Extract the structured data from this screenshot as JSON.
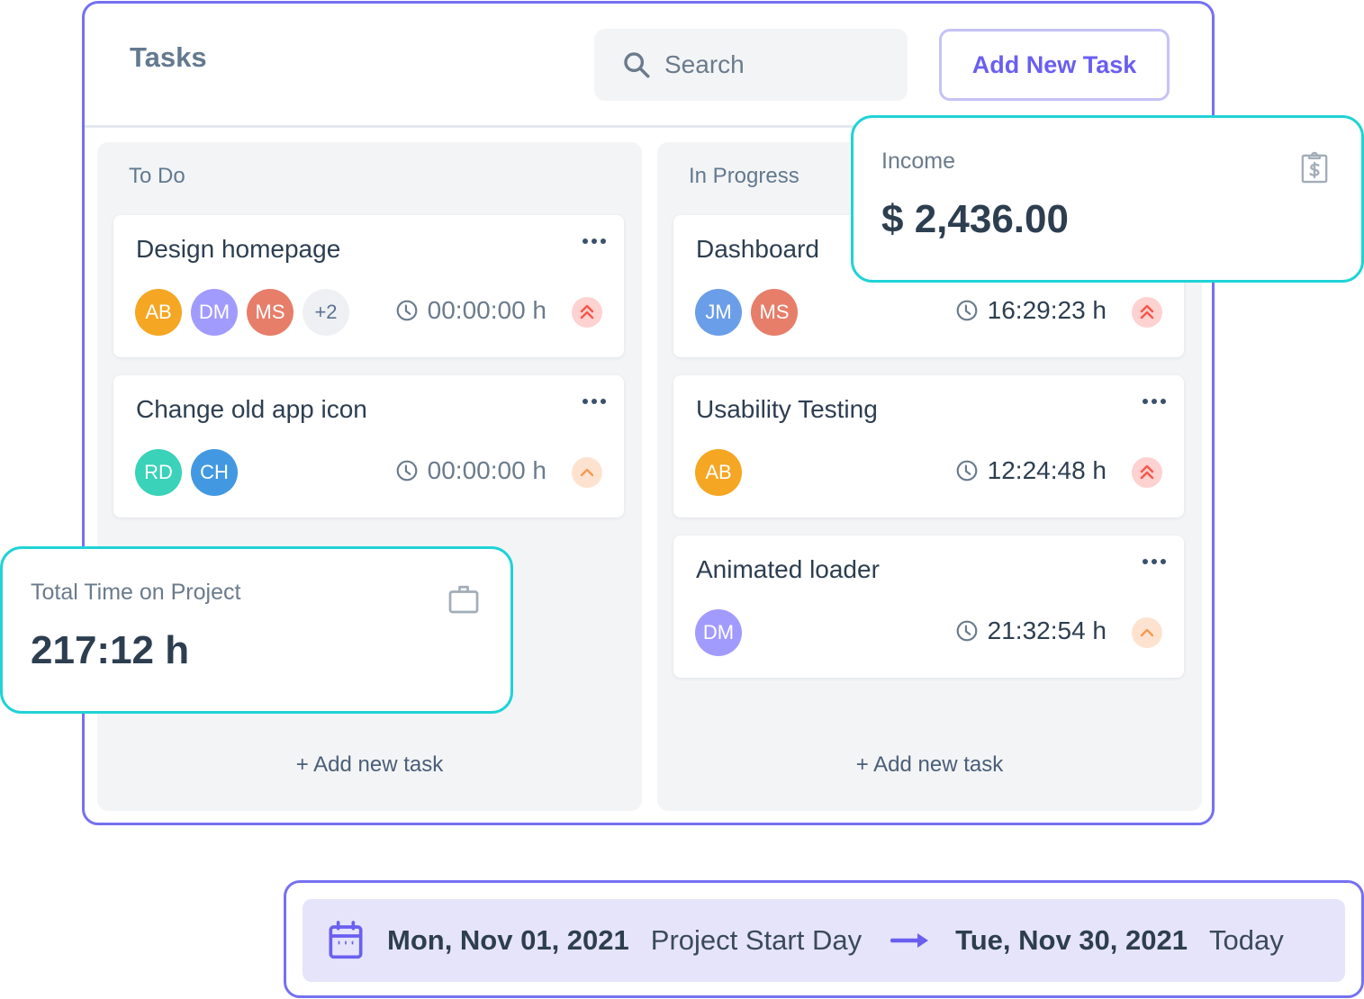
{
  "header": {
    "title": "Tasks",
    "search_placeholder": "Search",
    "search_value": "",
    "add_button": "Add New Task"
  },
  "columns": [
    {
      "title": "To Do",
      "add_label": "+ Add new task",
      "cards": [
        {
          "title": "Design homepage",
          "avatars": [
            {
              "initials": "AB",
              "color": "#f5a623"
            },
            {
              "initials": "DM",
              "color": "#a29bfe"
            },
            {
              "initials": "MS",
              "color": "#e67e6a"
            }
          ],
          "extra_count": "+2",
          "time": "00:00:00 h",
          "time_color": "#6b7b8c",
          "priority": "high"
        },
        {
          "title": "Change old app icon",
          "avatars": [
            {
              "initials": "RD",
              "color": "#3ad2b8"
            },
            {
              "initials": "CH",
              "color": "#4299e1"
            }
          ],
          "extra_count": "",
          "time": "00:00:00 h",
          "time_color": "#6b7b8c",
          "priority": "medium"
        }
      ]
    },
    {
      "title": "In Progress",
      "add_label": "+ Add new task",
      "cards": [
        {
          "title": "Dashboard",
          "avatars": [
            {
              "initials": "JM",
              "color": "#6b9ee8"
            },
            {
              "initials": "MS",
              "color": "#e67e6a"
            }
          ],
          "extra_count": "",
          "time": "16:29:23 h",
          "time_color": "#2d3e50",
          "priority": "high"
        },
        {
          "title": "Usability Testing",
          "avatars": [
            {
              "initials": "AB",
              "color": "#f5a623"
            }
          ],
          "extra_count": "",
          "time": "12:24:48 h",
          "time_color": "#2d3e50",
          "priority": "high"
        },
        {
          "title": "Animated loader",
          "avatars": [
            {
              "initials": "DM",
              "color": "#a29bfe"
            }
          ],
          "extra_count": "",
          "time": "21:32:54 h",
          "time_color": "#2d3e50",
          "priority": "medium"
        }
      ]
    }
  ],
  "income": {
    "label": "Income",
    "value": "$ 2,436.00",
    "icon": "clipboard-dollar-icon"
  },
  "total_time": {
    "label": "Total Time on Project",
    "value": "217:12 h",
    "icon": "briefcase-icon"
  },
  "date_range": {
    "start_date": "Mon, Nov 01, 2021",
    "start_label": "Project Start Day",
    "end_date": "Tue, Nov 30, 2021",
    "end_label": "Today",
    "icon": "calendar-icon"
  },
  "colors": {
    "accent": "#7570f2",
    "button_text": "#6a5ff0",
    "stat_border": "#1fd3d6",
    "priority_high": "#f5574b",
    "priority_medium": "#f39a55"
  }
}
